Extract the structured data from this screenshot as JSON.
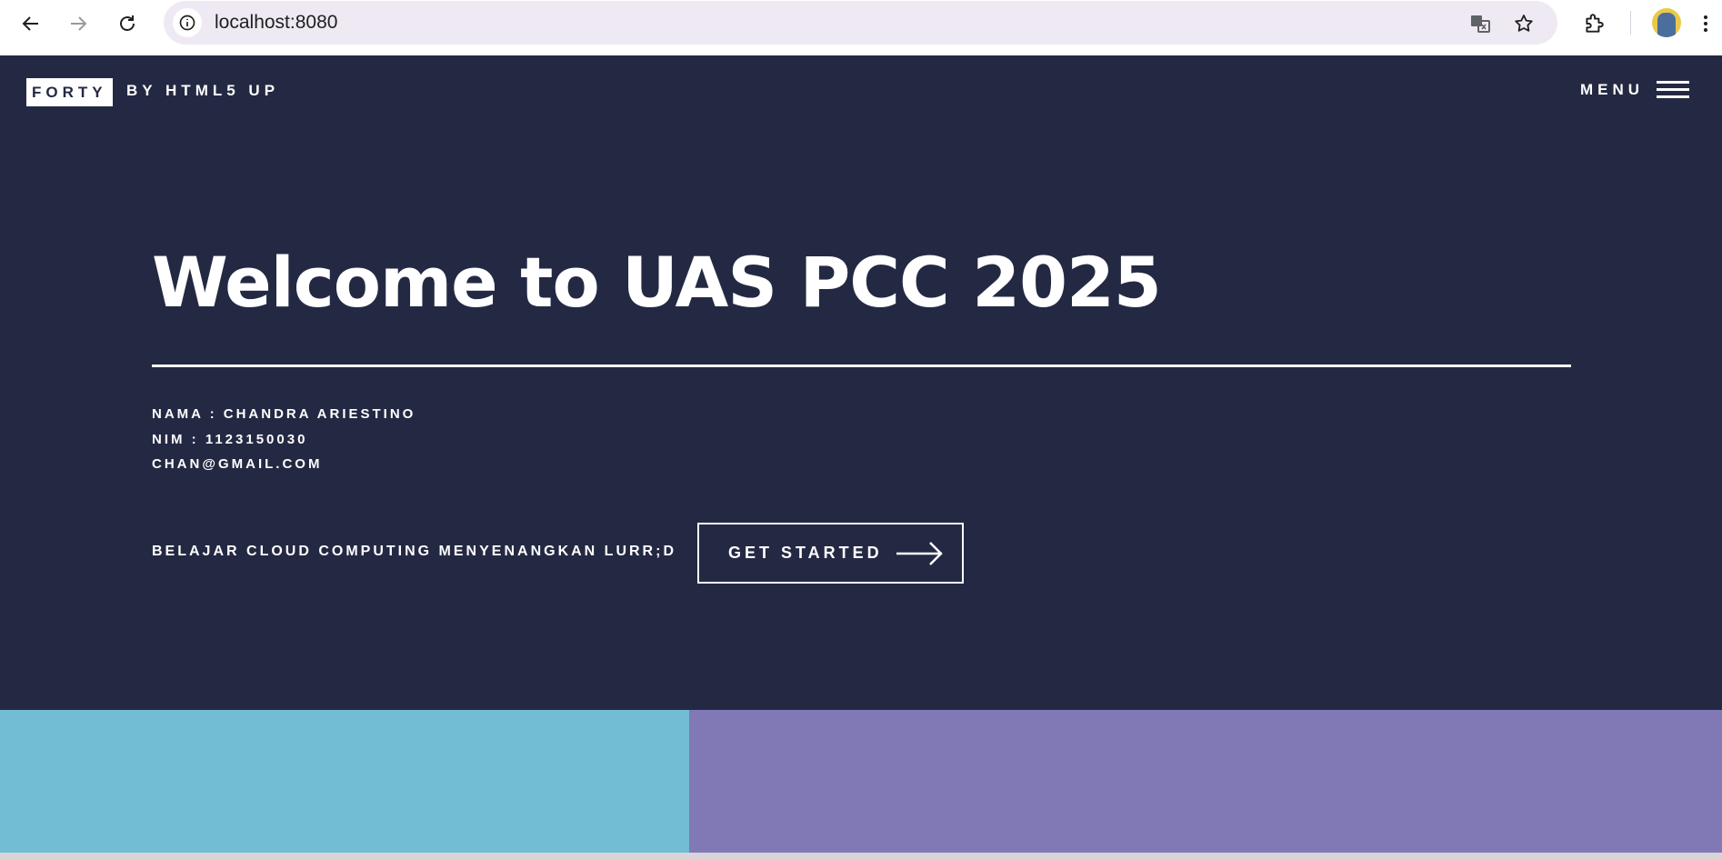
{
  "browser": {
    "url": "localhost:8080",
    "icons": {
      "back": "arrow-left-icon",
      "forward": "arrow-right-icon",
      "reload": "reload-icon",
      "site_info": "info-icon",
      "translate": "translate-icon",
      "bookmark": "star-icon",
      "extensions": "puzzle-icon",
      "profile": "avatar",
      "menu": "kebab-menu-icon"
    }
  },
  "header": {
    "logo": "FORTY",
    "logo_sub": "BY HTML5 UP",
    "menu_label": "MENU"
  },
  "banner": {
    "title": "Welcome to UAS PCC 2025",
    "info_lines": [
      "NAMA : CHANDRA ARIESTINO",
      "NIM : 1123150030",
      "CHAN@GMAIL.COM"
    ],
    "tagline": "BELAJAR CLOUD COMPUTING MENYENANGKAN LURR;D",
    "cta_label": "GET STARTED"
  },
  "colors": {
    "banner_bg": "#242943",
    "tile_1": "#72bcd4",
    "tile_2": "#8179b6"
  }
}
